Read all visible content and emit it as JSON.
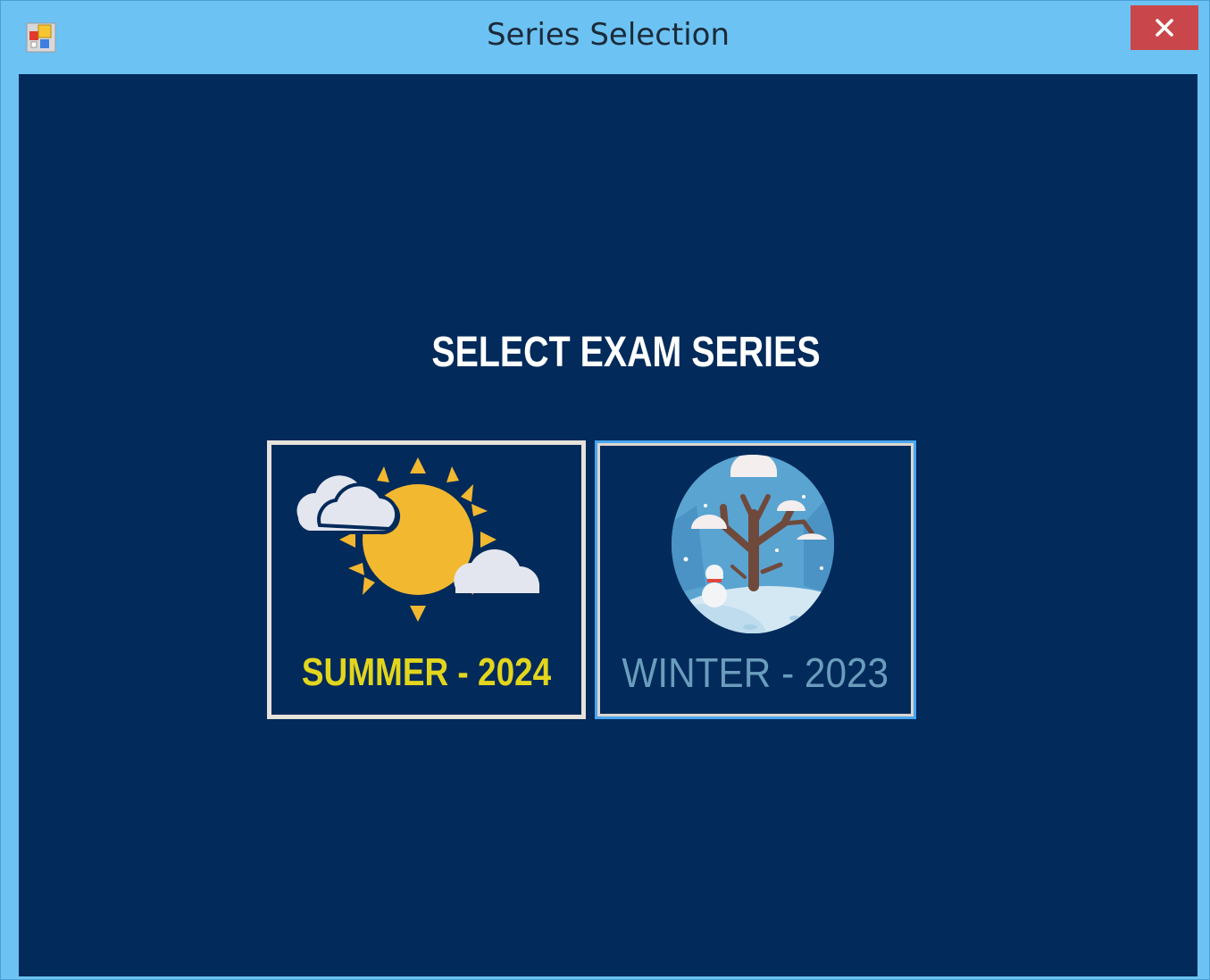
{
  "window": {
    "title": "Series Selection",
    "icons": {
      "app": "app-window-icon",
      "close": "close-icon"
    }
  },
  "main": {
    "heading": "SELECT EXAM SERIES",
    "options": [
      {
        "label": "SUMMER - 2024",
        "icon": "sun-with-clouds-icon"
      },
      {
        "label": "WINTER - 2023",
        "icon": "snowy-tree-icon"
      }
    ]
  },
  "colors": {
    "titlebar": "#6cc2f2",
    "client_background": "#022a5a",
    "close_button": "#c9474a",
    "summer_label": "#e2d51d",
    "winter_label": "#6a9dbd",
    "selected_border": "#4aa6f0"
  }
}
